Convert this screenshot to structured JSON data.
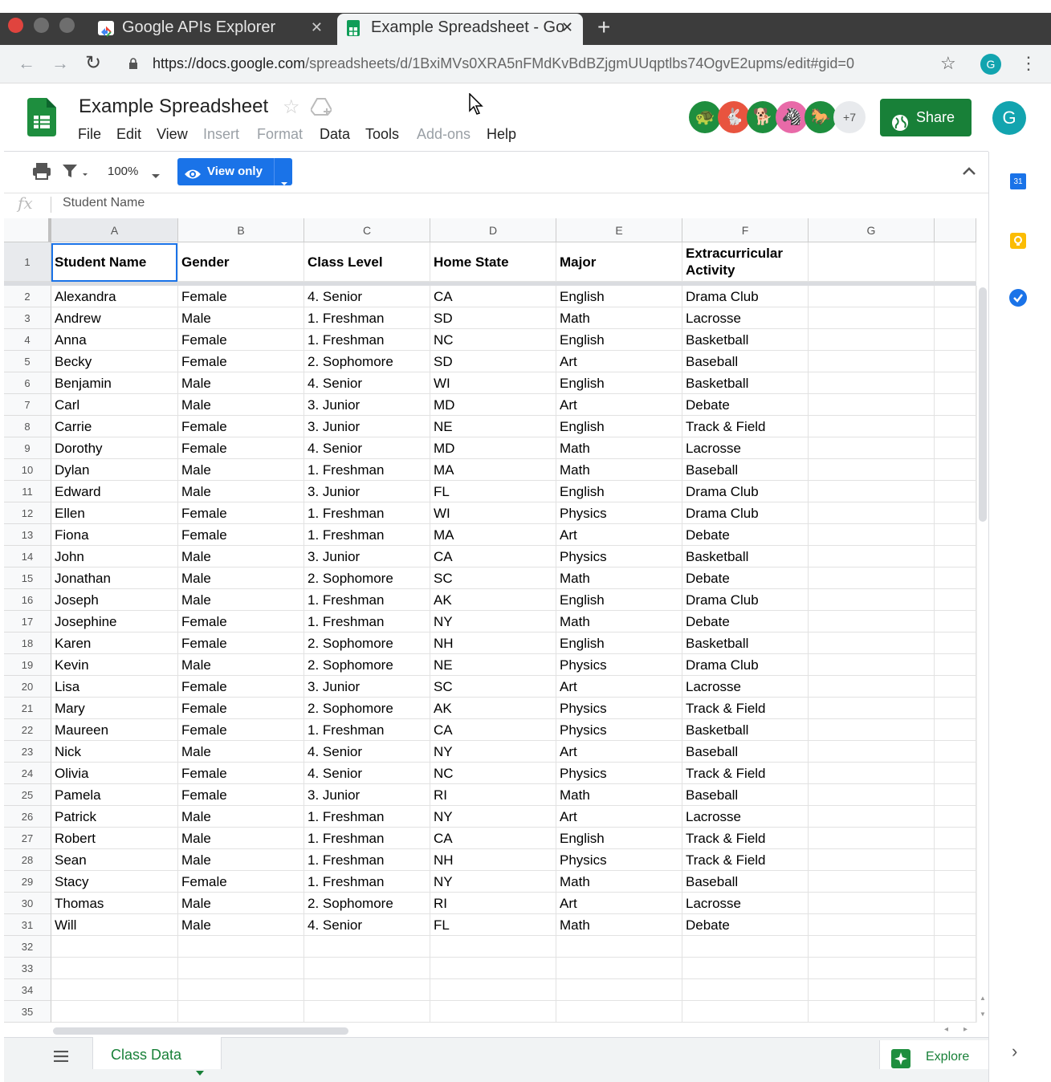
{
  "browser": {
    "tabs": [
      {
        "title": "Google APIs Explorer",
        "active": false
      },
      {
        "title": "Example Spreadsheet - Go",
        "active": true
      }
    ],
    "url_host": "https://docs.google.com",
    "url_path": "/spreadsheets/d/1BxiMVs0XRA5nFMdKvBdBZjgmUUqptlbs74OgvE2upms/edit#gid=0",
    "profile_initial": "G"
  },
  "doc": {
    "title": "Example Spreadsheet",
    "menu": [
      {
        "label": "File",
        "enabled": true
      },
      {
        "label": "Edit",
        "enabled": true
      },
      {
        "label": "View",
        "enabled": true
      },
      {
        "label": "Insert",
        "enabled": false
      },
      {
        "label": "Format",
        "enabled": false
      },
      {
        "label": "Data",
        "enabled": true
      },
      {
        "label": "Tools",
        "enabled": true
      },
      {
        "label": "Add-ons",
        "enabled": false
      },
      {
        "label": "Help",
        "enabled": true
      }
    ],
    "collaborators_more": "+7",
    "share_label": "Share",
    "account_initial": "G"
  },
  "toolbar": {
    "zoom": "100%",
    "view_only_label": "View only"
  },
  "formula_bar": {
    "fx": "fx",
    "value": "Student Name"
  },
  "sheet": {
    "columns": [
      "A",
      "B",
      "C",
      "D",
      "E",
      "F",
      "G"
    ],
    "header_row": [
      "Student Name",
      "Gender",
      "Class Level",
      "Home State",
      "Major",
      "Extracurricular Activity",
      ""
    ],
    "rows": [
      [
        "Alexandra",
        "Female",
        "4. Senior",
        "CA",
        "English",
        "Drama Club"
      ],
      [
        "Andrew",
        "Male",
        "1. Freshman",
        "SD",
        "Math",
        "Lacrosse"
      ],
      [
        "Anna",
        "Female",
        "1. Freshman",
        "NC",
        "English",
        "Basketball"
      ],
      [
        "Becky",
        "Female",
        "2. Sophomore",
        "SD",
        "Art",
        "Baseball"
      ],
      [
        "Benjamin",
        "Male",
        "4. Senior",
        "WI",
        "English",
        "Basketball"
      ],
      [
        "Carl",
        "Male",
        "3. Junior",
        "MD",
        "Art",
        "Debate"
      ],
      [
        "Carrie",
        "Female",
        "3. Junior",
        "NE",
        "English",
        "Track & Field"
      ],
      [
        "Dorothy",
        "Female",
        "4. Senior",
        "MD",
        "Math",
        "Lacrosse"
      ],
      [
        "Dylan",
        "Male",
        "1. Freshman",
        "MA",
        "Math",
        "Baseball"
      ],
      [
        "Edward",
        "Male",
        "3. Junior",
        "FL",
        "English",
        "Drama Club"
      ],
      [
        "Ellen",
        "Female",
        "1. Freshman",
        "WI",
        "Physics",
        "Drama Club"
      ],
      [
        "Fiona",
        "Female",
        "1. Freshman",
        "MA",
        "Art",
        "Debate"
      ],
      [
        "John",
        "Male",
        "3. Junior",
        "CA",
        "Physics",
        "Basketball"
      ],
      [
        "Jonathan",
        "Male",
        "2. Sophomore",
        "SC",
        "Math",
        "Debate"
      ],
      [
        "Joseph",
        "Male",
        "1. Freshman",
        "AK",
        "English",
        "Drama Club"
      ],
      [
        "Josephine",
        "Female",
        "1. Freshman",
        "NY",
        "Math",
        "Debate"
      ],
      [
        "Karen",
        "Female",
        "2. Sophomore",
        "NH",
        "English",
        "Basketball"
      ],
      [
        "Kevin",
        "Male",
        "2. Sophomore",
        "NE",
        "Physics",
        "Drama Club"
      ],
      [
        "Lisa",
        "Female",
        "3. Junior",
        "SC",
        "Art",
        "Lacrosse"
      ],
      [
        "Mary",
        "Female",
        "2. Sophomore",
        "AK",
        "Physics",
        "Track & Field"
      ],
      [
        "Maureen",
        "Female",
        "1. Freshman",
        "CA",
        "Physics",
        "Basketball"
      ],
      [
        "Nick",
        "Male",
        "4. Senior",
        "NY",
        "Art",
        "Baseball"
      ],
      [
        "Olivia",
        "Female",
        "4. Senior",
        "NC",
        "Physics",
        "Track & Field"
      ],
      [
        "Pamela",
        "Female",
        "3. Junior",
        "RI",
        "Math",
        "Baseball"
      ],
      [
        "Patrick",
        "Male",
        "1. Freshman",
        "NY",
        "Art",
        "Lacrosse"
      ],
      [
        "Robert",
        "Male",
        "1. Freshman",
        "CA",
        "English",
        "Track & Field"
      ],
      [
        "Sean",
        "Male",
        "1. Freshman",
        "NH",
        "Physics",
        "Track & Field"
      ],
      [
        "Stacy",
        "Female",
        "1. Freshman",
        "NY",
        "Math",
        "Baseball"
      ],
      [
        "Thomas",
        "Male",
        "2. Sophomore",
        "RI",
        "Art",
        "Lacrosse"
      ],
      [
        "Will",
        "Male",
        "4. Senior",
        "FL",
        "Math",
        "Debate"
      ],
      [
        "",
        "",
        "",
        "",
        "",
        ""
      ],
      [
        "",
        "",
        "",
        "",
        "",
        ""
      ],
      [
        "",
        "",
        "",
        "",
        "",
        ""
      ],
      [
        "",
        "",
        "",
        "",
        "",
        ""
      ]
    ],
    "row_numbers": [
      "1",
      "2",
      "3",
      "4",
      "5",
      "6",
      "7",
      "8",
      "9",
      "10",
      "11",
      "12",
      "13",
      "14",
      "15",
      "16",
      "17",
      "18",
      "19",
      "20",
      "21",
      "22",
      "23",
      "24",
      "25",
      "26",
      "27",
      "28",
      "29",
      "30",
      "31",
      "32",
      "33",
      "34",
      "35"
    ]
  },
  "bottom": {
    "sheet_tab": "Class Data",
    "explore_label": "Explore"
  },
  "side_panel": {
    "calendar_day": "31"
  },
  "colors": {
    "sheets_green": "#1e8e3e",
    "share_green": "#188038",
    "view_only_blue": "#1a73e8",
    "tab_strip": "#3c3c3c"
  }
}
